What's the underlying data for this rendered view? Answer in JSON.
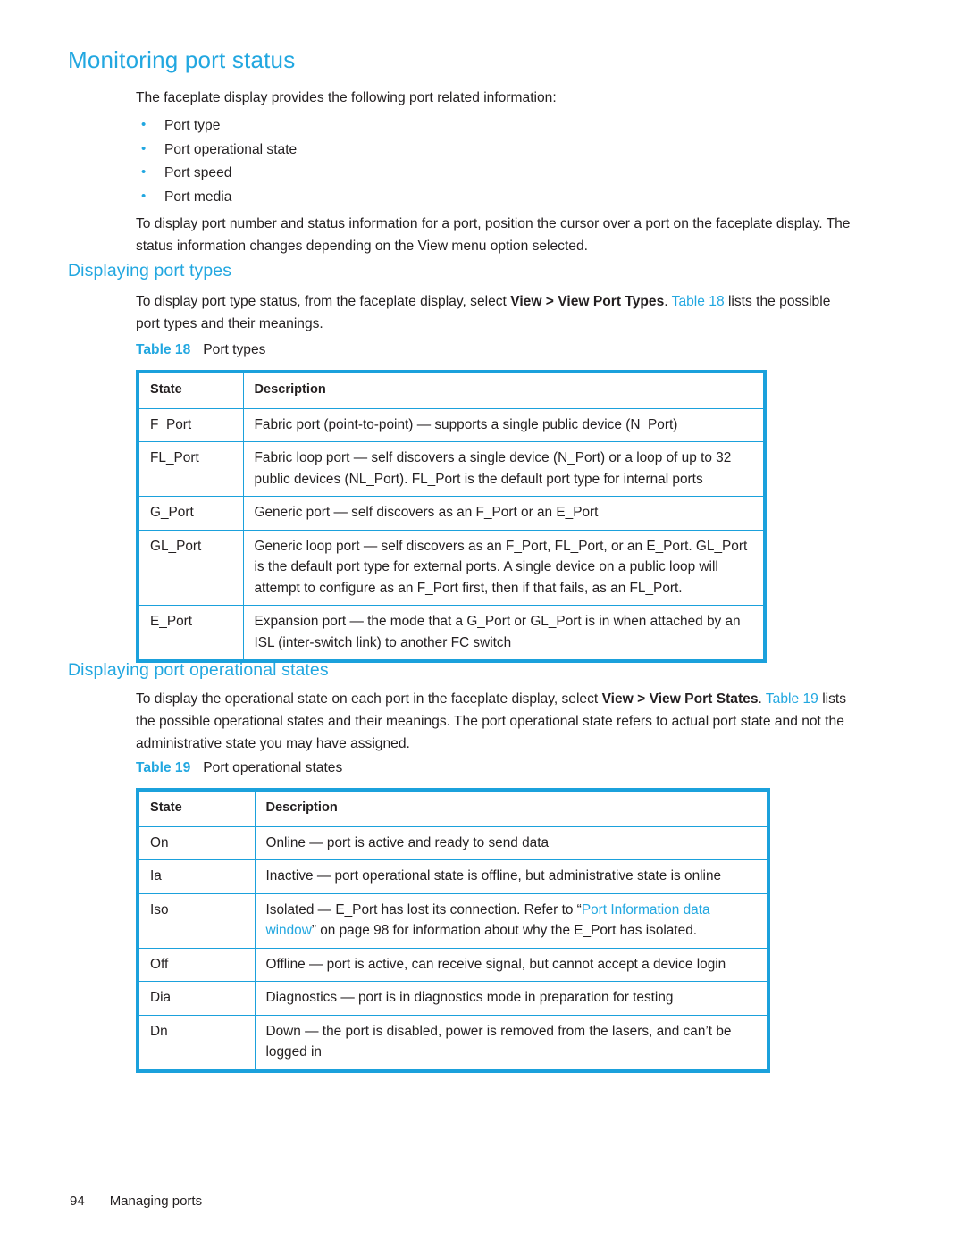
{
  "page": {
    "title": "Monitoring port status",
    "footer": {
      "page_number": "94",
      "chapter": "Managing ports"
    }
  },
  "intro": {
    "paragraph": "The faceplate display provides the following port related information:",
    "bullets": [
      "Port type",
      "Port operational state",
      "Port speed",
      "Port media"
    ],
    "cursor_paragraph": "To display port number and status information for a port, position the cursor over a port on the faceplate display. The status information changes depending on the View menu option selected."
  },
  "port_types_section": {
    "heading": "Displaying port types",
    "paragraph_before_bold": "To display port type status, from the faceplate display, select ",
    "menu_path": "View > View Port Types",
    "paragraph_after_bold": ". ",
    "table_link": "Table 18",
    "paragraph_end": " lists the possible port types and their meanings.",
    "caption_label": "Table 18",
    "caption_text": "Port types",
    "table": {
      "columns": [
        "State",
        "Description"
      ],
      "rows": [
        {
          "state": "F_Port",
          "description": "Fabric port (point-to-point) — supports a single public device (N_Port)"
        },
        {
          "state": "FL_Port",
          "description": "Fabric loop port — self discovers a single device (N_Port) or a loop of up to 32 public devices (NL_Port). FL_Port is the default port type for internal ports"
        },
        {
          "state": "G_Port",
          "description": "Generic port — self discovers as an F_Port or an E_Port"
        },
        {
          "state": "GL_Port",
          "description": "Generic loop port — self discovers as an F_Port, FL_Port, or an E_Port. GL_Port is the default port type for external ports. A single device on a public loop will attempt to configure as an F_Port first, then if that fails, as an FL_Port."
        },
        {
          "state": "E_Port",
          "description": "Expansion port — the mode that a G_Port or GL_Port is in when attached by an ISL (inter-switch link) to another FC switch"
        }
      ]
    }
  },
  "port_states_section": {
    "heading": "Displaying port operational states",
    "paragraph_before_bold": "To display the operational state on each port in the faceplate display, select ",
    "menu_path": "View > View Port States",
    "paragraph_after_bold": ". ",
    "table_link": "Table 19",
    "paragraph_end": " lists the possible operational states and their meanings. The port operational state refers to actual port state and not the administrative state you may have assigned.",
    "caption_label": "Table 19",
    "caption_text": "Port operational states",
    "table": {
      "columns": [
        "State",
        "Description"
      ],
      "rows": [
        {
          "state": "On",
          "description": "Online — port is active and ready to send data"
        },
        {
          "state": "Ia",
          "description": "Inactive — port operational state is offline, but administrative state is online"
        },
        {
          "state": "Iso",
          "description_pre": "Isolated — E_Port has lost its connection. Refer to “",
          "description_link": "Port Information data window",
          "description_post": "” on page 98 for information about why the E_Port has isolated."
        },
        {
          "state": "Off",
          "description": "Offline — port is active, can receive signal, but cannot accept a device login"
        },
        {
          "state": "Dia",
          "description": "Diagnostics — port is in diagnostics mode in preparation for testing"
        },
        {
          "state": "Dn",
          "description": "Down — the port is disabled, power is removed from the lasers, and can’t be logged in"
        }
      ]
    }
  },
  "colors": {
    "heading_cyan": "#22A7E0",
    "table_border": "#1BA1DC",
    "body_text": "#231f20"
  }
}
